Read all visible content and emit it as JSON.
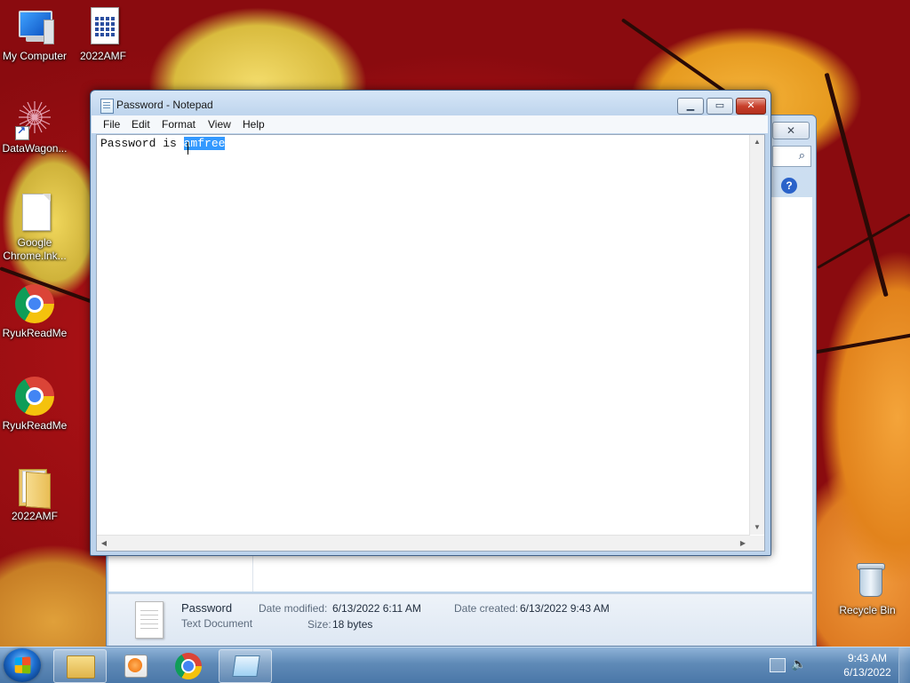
{
  "desktop": {
    "icons": [
      {
        "label": "My Computer"
      },
      {
        "label": "2022AMF"
      },
      {
        "label": "DataWagon..."
      },
      {
        "label": "Google Chrome.lnk..."
      },
      {
        "label": "RyukReadMe"
      },
      {
        "label": "RyukReadMe"
      },
      {
        "label": "2022AMF"
      },
      {
        "label": "Recycle Bin"
      }
    ]
  },
  "notepad": {
    "title": "Password - Notepad",
    "menu": [
      "File",
      "Edit",
      "Format",
      "View",
      "Help"
    ],
    "content_prefix": "Password is ",
    "content_selected": "amfree",
    "controls": {
      "minimize": "▁",
      "maximize": "▭",
      "close": "✕"
    }
  },
  "explorer": {
    "details": {
      "file_name": "Password",
      "file_type": "Text Document",
      "date_modified_label": "Date modified:",
      "date_modified_value": "6/13/2022 6:11 AM",
      "size_label": "Size:",
      "size_value": "18 bytes",
      "date_created_label": "Date created:",
      "date_created_value": "6/13/2022 9:43 AM"
    },
    "close_glyph": "✕",
    "search_glyph": "⌕",
    "help_glyph": "?"
  },
  "taskbar": {
    "pinned": [
      "explorer-icon",
      "media-player-icon",
      "chrome-icon",
      "notepad-icon"
    ],
    "clock_time": "9:43 AM",
    "clock_date": "6/13/2022",
    "volume_glyph": "🔈"
  }
}
